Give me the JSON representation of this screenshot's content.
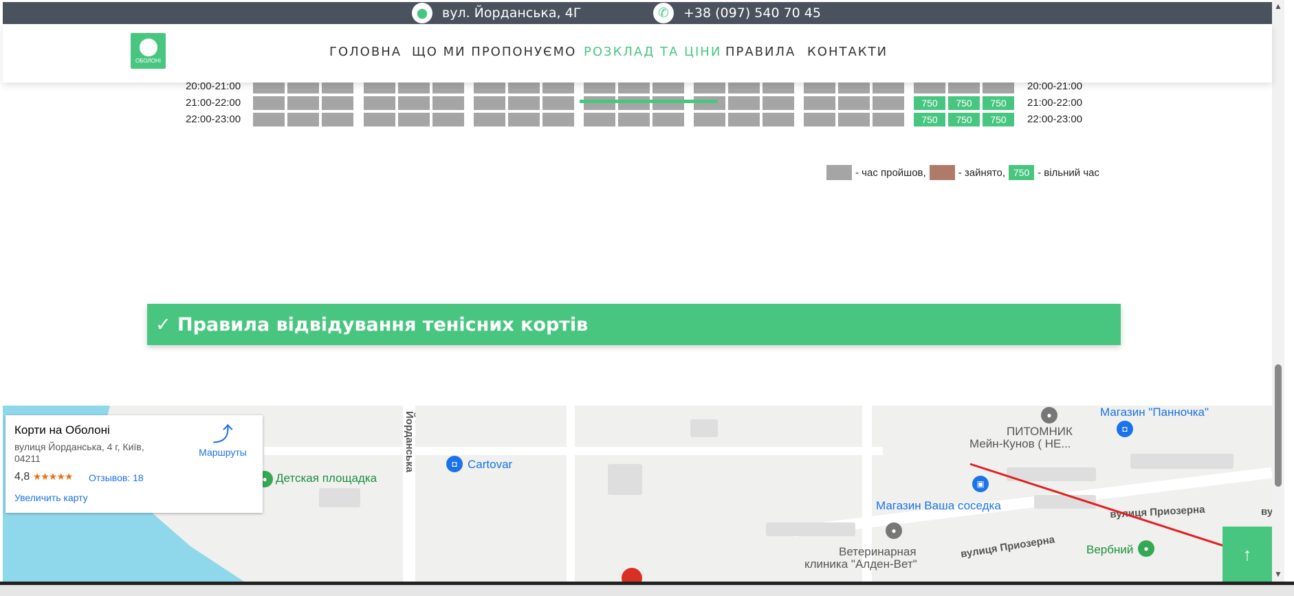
{
  "topbar": {
    "address": "вул. Йорданська, 4Г",
    "phone": "+38 (097) 540 70 45",
    "address_icon": "map-pin-icon",
    "phone_icon": "phone-icon"
  },
  "header": {
    "logo_text": "ОБОЛОНІ",
    "nav": [
      {
        "label": "ГОЛОВНА",
        "active": false
      },
      {
        "label": "ЩО МИ ПРОПОНУЄМО",
        "active": false
      },
      {
        "label": "РОЗКЛАД ТА ЦІНИ",
        "active": true
      },
      {
        "label": "ПРАВИЛА",
        "active": false
      },
      {
        "label": "КОНТАКТИ",
        "active": false
      }
    ]
  },
  "schedule": {
    "rows": [
      {
        "time": "20:00-21:00",
        "free_value": ""
      },
      {
        "time": "21:00-22:00",
        "free_value": "750"
      },
      {
        "time": "22:00-23:00",
        "free_value": "750"
      }
    ]
  },
  "legend": {
    "past_text": "- час пройшов,",
    "busy_text": "- зайнято,",
    "free_value": "750",
    "free_text": "- вільний час"
  },
  "rules_banner": "✓ Правила відвідування тенісних кортів",
  "map": {
    "card": {
      "name": "Корти на Оболоні",
      "address": "вулиця Йорданська, 4 г, Київ, 04211",
      "rating": "4,8",
      "stars": "★★★★★",
      "reviews": "Отзывов: 18",
      "enlarge": "Увеличить карту",
      "directions": "Маршруты"
    },
    "labels": {
      "street_yordanska": "Йорданська",
      "playground": "Детская площадка",
      "cartovar": "Cartovar",
      "pannochka": "Магазин \"Панночка\"",
      "pitomnik": "ПИТОМНИК",
      "mein_kunov": "Мейн-Кунов (  НЕ...",
      "vasha_sosedka": "Магазин Ваша соседка",
      "vet_clinic_1": "Ветеринарная",
      "vet_clinic_2": "клиника \"Алден-Вет\"",
      "priozerna_1": "вулиця Приозерна",
      "priozerna_2": "вулиця Приозерна",
      "verbnyi": "Вербний",
      "vu": "ву"
    }
  },
  "scroll_top_icon": "arrow-up-icon"
}
